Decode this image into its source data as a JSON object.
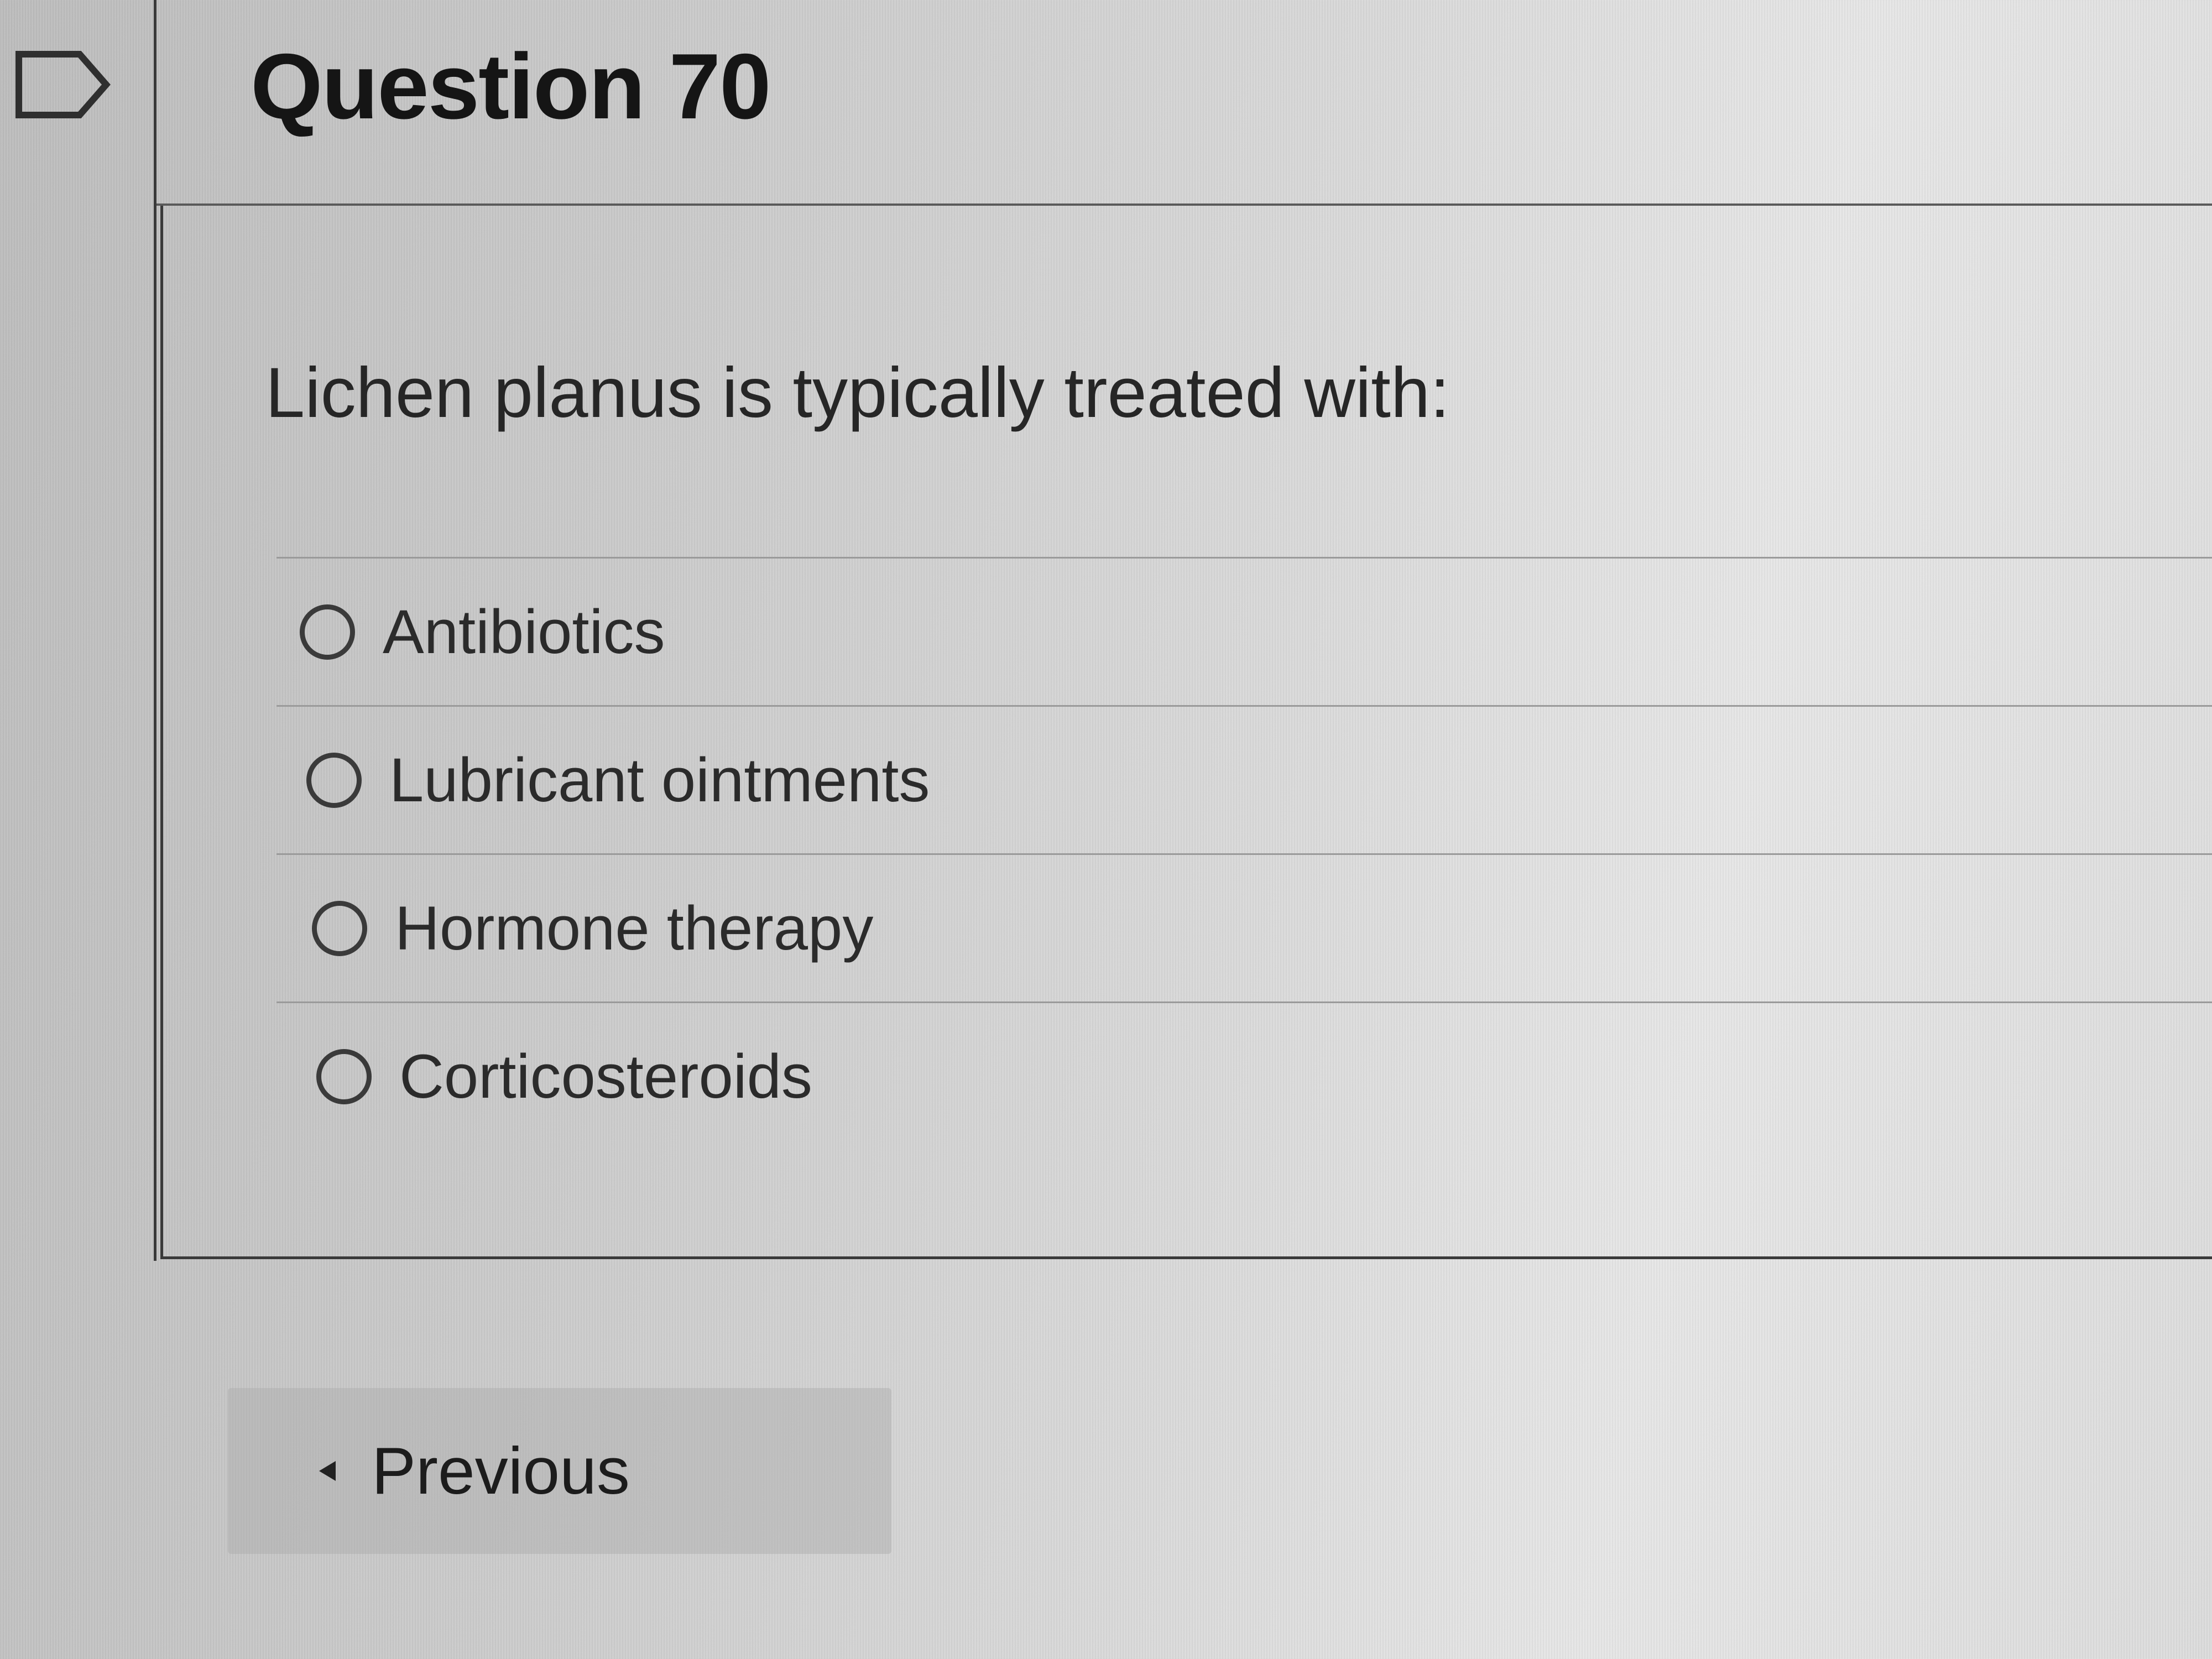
{
  "question": {
    "title": "Question 70",
    "text": "Lichen planus is typically treated with:",
    "options": [
      {
        "label": "Antibiotics",
        "selected": false
      },
      {
        "label": "Lubricant ointments",
        "selected": false
      },
      {
        "label": "Hormone therapy",
        "selected": false
      },
      {
        "label": "Corticosteroids",
        "selected": false
      }
    ]
  },
  "navigation": {
    "previous_label": "Previous"
  },
  "icons": {
    "flag": "flag-icon",
    "previous": "caret-left-icon",
    "radio": "radio-button-icon"
  }
}
